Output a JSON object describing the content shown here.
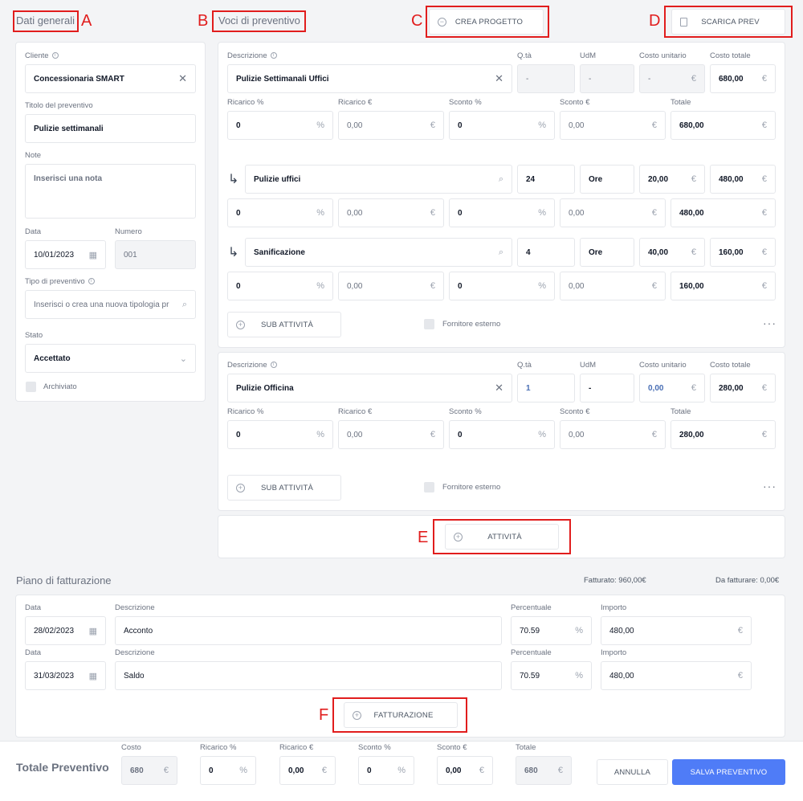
{
  "tabs": {
    "a": "A",
    "b": "B",
    "c": "C",
    "d": "D",
    "e": "E",
    "f": "F"
  },
  "sections": {
    "general": "Dati generali",
    "items": "Voci di preventivo",
    "billing": "Piano di fatturazione"
  },
  "top_buttons": {
    "crea_progetto": "CREA PROGETTO",
    "scarica_prev": "SCARICA PREV"
  },
  "general": {
    "cliente_label": "Cliente",
    "cliente_value": "Concessionaria SMART",
    "titolo_label": "Titolo del preventivo",
    "titolo_value": "Pulizie settimanali",
    "note_label": "Note",
    "note_placeholder": "Inserisci una nota",
    "data_label": "Data",
    "data_value": "10/01/2023",
    "numero_label": "Numero",
    "numero_value": "001",
    "tipo_label": "Tipo di preventivo",
    "tipo_placeholder": "Inserisci o crea una nuova tipologia pr",
    "stato_label": "Stato",
    "stato_value": "Accettato",
    "archiviato_label": "Archiviato"
  },
  "labels": {
    "descrizione": "Descrizione",
    "qta": "Q.tà",
    "udm": "UdM",
    "costo_unitario": "Costo unitario",
    "costo_totale": "Costo totale",
    "ricarico_pct": "Ricarico %",
    "ricarico_eur": "Ricarico €",
    "sconto_pct": "Sconto %",
    "sconto_eur": "Sconto €",
    "totale": "Totale",
    "pct": "%",
    "eur": "€",
    "sub_attivita": "SUB ATTIVITÀ",
    "fornitore": "Fornitore esterno",
    "dots": "···",
    "dash": "-"
  },
  "item1": {
    "descrizione": "Pulizie Settimanali Uffici",
    "qta": "-",
    "udm": "-",
    "costo_unitario": "-",
    "costo_totale": "680,00",
    "ric_pct": "0",
    "ric_eur": "0,00",
    "sc_pct": "0",
    "sc_eur": "0,00",
    "totale": "680,00",
    "subs": [
      {
        "descrizione": "Pulizie uffici",
        "qta": "24",
        "udm": "Ore",
        "costo_unitario": "20,00",
        "costo_totale": "480,00",
        "ric_pct": "0",
        "ric_eur": "0,00",
        "sc_pct": "0",
        "sc_eur": "0,00",
        "totale": "480,00"
      },
      {
        "descrizione": "Sanificazione",
        "qta": "4",
        "udm": "Ore",
        "costo_unitario": "40,00",
        "costo_totale": "160,00",
        "ric_pct": "0",
        "ric_eur": "0,00",
        "sc_pct": "0",
        "sc_eur": "0,00",
        "totale": "160,00"
      }
    ]
  },
  "item2": {
    "descrizione": "Pulizie Officina",
    "qta": "1",
    "udm": "-",
    "costo_unitario": "0,00",
    "costo_totale": "280,00",
    "ric_pct": "0",
    "ric_eur": "0,00",
    "sc_pct": "0",
    "sc_eur": "0,00",
    "totale": "280,00"
  },
  "attivita_button": "ATTIVITÀ",
  "billing": {
    "fatturato": "Fatturato: 960,00€",
    "da_fatturare": "Da fatturare: 0,00€",
    "data_label": "Data",
    "descrizione_label": "Descrizione",
    "percentuale_label": "Percentuale",
    "importo_label": "Importo",
    "rows": [
      {
        "data": "28/02/2023",
        "descrizione": "Acconto",
        "percentuale": "70.59",
        "importo": "480,00"
      },
      {
        "data": "31/03/2023",
        "descrizione": "Saldo",
        "percentuale": "70.59",
        "importo": "480,00"
      }
    ],
    "fatturazione_button": "FATTURAZIONE"
  },
  "footer": {
    "title": "Totale Preventivo",
    "costo_label": "Costo",
    "costo": "680",
    "ric_pct_label": "Ricarico %",
    "ric_pct": "0",
    "ric_eur_label": "Ricarico €",
    "ric_eur": "0,00",
    "sc_pct_label": "Sconto %",
    "sc_pct": "0",
    "sc_eur_label": "Sconto €",
    "sc_eur": "0,00",
    "totale_label": "Totale",
    "totale": "680",
    "annulla": "ANNULLA",
    "salva": "SALVA PREVENTIVO"
  },
  "colors": {
    "primary": "#4f7cf7",
    "annotation": "#e11d1d"
  }
}
